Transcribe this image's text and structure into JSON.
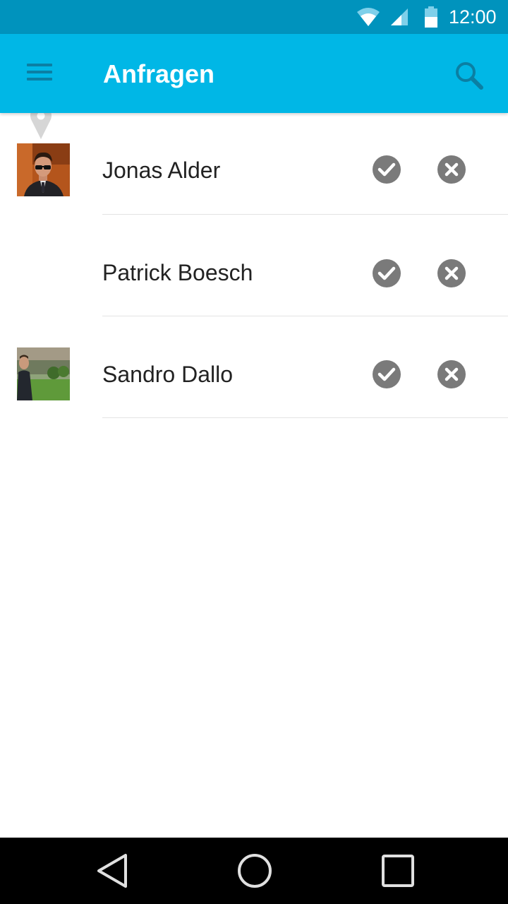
{
  "status_bar": {
    "time": "12:00",
    "icons": [
      "wifi-icon",
      "cell-signal-icon",
      "battery-icon"
    ],
    "background_color": "#0093bd"
  },
  "app_bar": {
    "title": "Anfragen",
    "menu_icon": "menu-icon",
    "search_icon": "search-icon",
    "background_color": "#00b7e6"
  },
  "requests": [
    {
      "name": "Jonas Alder",
      "avatar": "photo-man-sunglasses-suit",
      "accept_icon": "check-circle-icon",
      "decline_icon": "cancel-circle-icon"
    },
    {
      "name": "Patrick Boesch",
      "avatar": "location-pin-placeholder",
      "accept_icon": "check-circle-icon",
      "decline_icon": "cancel-circle-icon"
    },
    {
      "name": "Sandro Dallo",
      "avatar": "photo-man-outdoor-green",
      "accept_icon": "check-circle-icon",
      "decline_icon": "cancel-circle-icon"
    }
  ],
  "action_icon_color": "#7a7a7a",
  "nav_bar": {
    "icons": [
      "back-icon",
      "home-icon",
      "recents-icon"
    ]
  }
}
